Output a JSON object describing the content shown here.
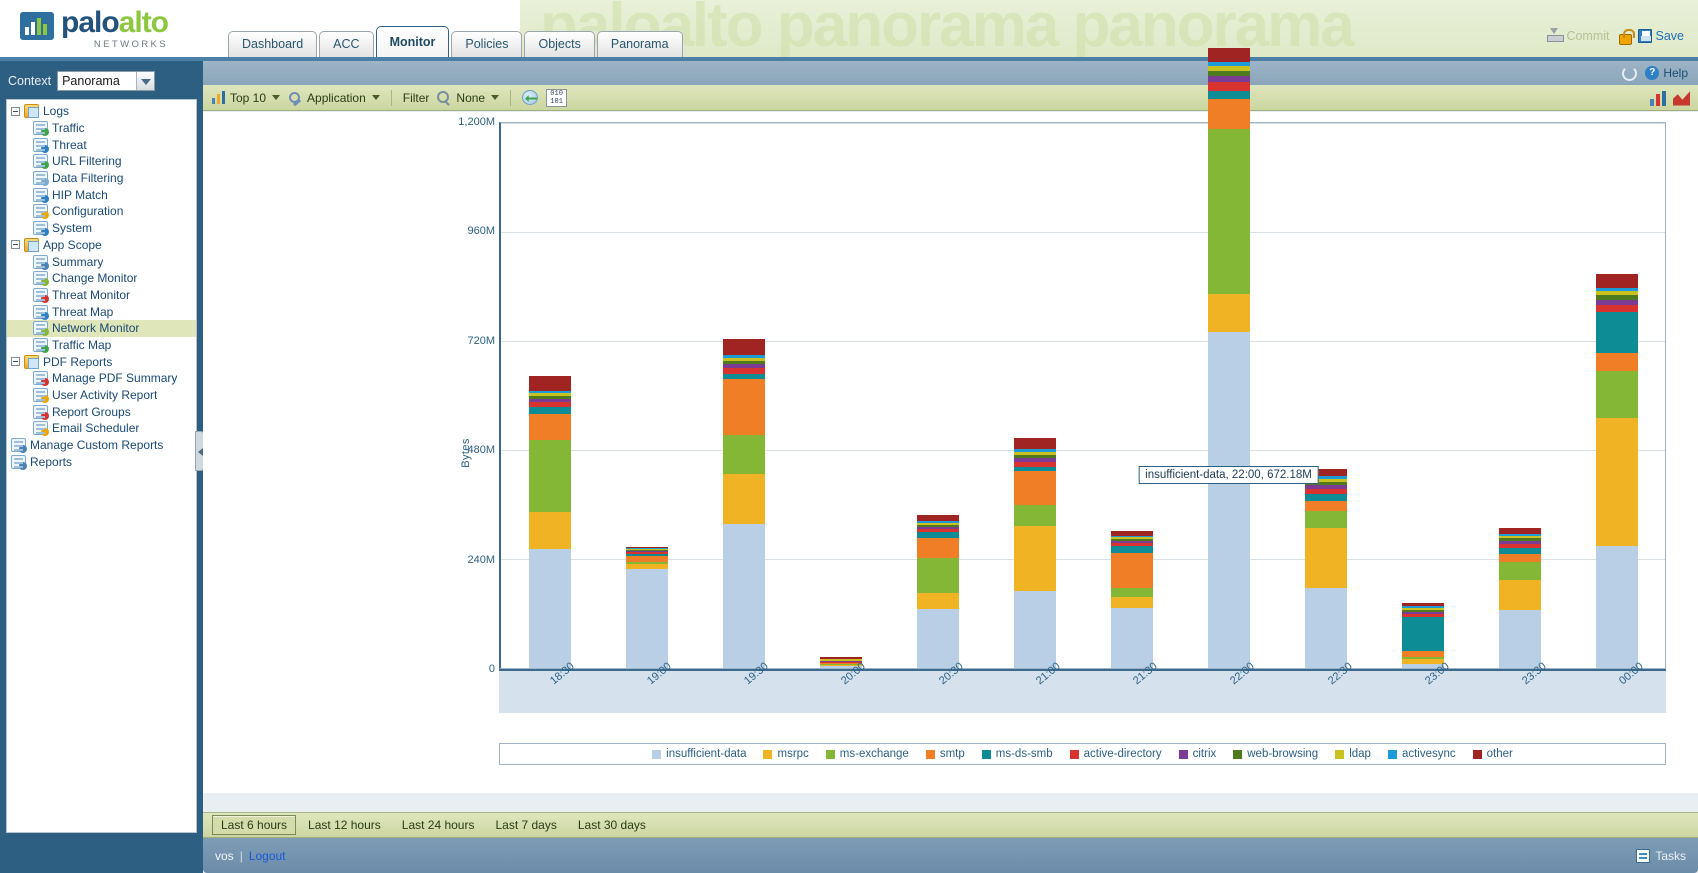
{
  "brand": {
    "name_part1": "palo",
    "name_part2": "alto",
    "tagline": "NETWORKS",
    "watermark": "paloalto panorama panorama"
  },
  "topbar": {
    "tabs": [
      {
        "label": "Dashboard",
        "active": false
      },
      {
        "label": "ACC",
        "active": false
      },
      {
        "label": "Monitor",
        "active": true
      },
      {
        "label": "Policies",
        "active": false
      },
      {
        "label": "Objects",
        "active": false
      },
      {
        "label": "Panorama",
        "active": false
      }
    ],
    "commit_label": "Commit",
    "save_label": "Save"
  },
  "context": {
    "label": "Context",
    "value": "Panorama"
  },
  "sidebar": {
    "items": [
      {
        "label": "Logs",
        "level": 1,
        "icon": "folder-icon",
        "expandable": true,
        "selected": false
      },
      {
        "label": "Traffic",
        "level": 2,
        "icon": "traffic-log-icon",
        "expandable": false,
        "selected": false
      },
      {
        "label": "Threat",
        "level": 2,
        "icon": "threat-log-icon",
        "expandable": false,
        "selected": false
      },
      {
        "label": "URL Filtering",
        "level": 2,
        "icon": "url-filtering-icon",
        "expandable": false,
        "selected": false
      },
      {
        "label": "Data Filtering",
        "level": 2,
        "icon": "data-filtering-icon",
        "expandable": false,
        "selected": false
      },
      {
        "label": "HIP Match",
        "level": 2,
        "icon": "hip-match-icon",
        "expandable": false,
        "selected": false
      },
      {
        "label": "Configuration",
        "level": 2,
        "icon": "configuration-icon",
        "expandable": false,
        "selected": false
      },
      {
        "label": "System",
        "level": 2,
        "icon": "system-icon",
        "expandable": false,
        "selected": false
      },
      {
        "label": "App Scope",
        "level": 1,
        "icon": "app-scope-icon",
        "expandable": true,
        "selected": false
      },
      {
        "label": "Summary",
        "level": 2,
        "icon": "summary-icon",
        "expandable": false,
        "selected": false
      },
      {
        "label": "Change Monitor",
        "level": 2,
        "icon": "change-monitor-icon",
        "expandable": false,
        "selected": false
      },
      {
        "label": "Threat Monitor",
        "level": 2,
        "icon": "threat-monitor-icon",
        "expandable": false,
        "selected": false
      },
      {
        "label": "Threat Map",
        "level": 2,
        "icon": "threat-map-icon",
        "expandable": false,
        "selected": false
      },
      {
        "label": "Network Monitor",
        "level": 2,
        "icon": "network-monitor-icon",
        "expandable": false,
        "selected": true
      },
      {
        "label": "Traffic Map",
        "level": 2,
        "icon": "traffic-map-icon",
        "expandable": false,
        "selected": false
      },
      {
        "label": "PDF Reports",
        "level": 1,
        "icon": "pdf-reports-icon",
        "expandable": true,
        "selected": false
      },
      {
        "label": "Manage PDF Summary",
        "level": 2,
        "icon": "manage-pdf-icon",
        "expandable": false,
        "selected": false
      },
      {
        "label": "User Activity Report",
        "level": 2,
        "icon": "user-activity-icon",
        "expandable": false,
        "selected": false
      },
      {
        "label": "Report Groups",
        "level": 2,
        "icon": "report-groups-icon",
        "expandable": false,
        "selected": false
      },
      {
        "label": "Email Scheduler",
        "level": 2,
        "icon": "email-scheduler-icon",
        "expandable": false,
        "selected": false
      },
      {
        "label": "Manage Custom Reports",
        "level": 1,
        "icon": "custom-reports-icon",
        "expandable": false,
        "selected": false
      },
      {
        "label": "Reports",
        "level": 1,
        "icon": "reports-icon",
        "expandable": false,
        "selected": false
      }
    ]
  },
  "main_header": {
    "help_label": "Help",
    "help_glyph": "?"
  },
  "toolbar": {
    "top_n": "Top 10",
    "group_by": "Application",
    "filter_label": "Filter",
    "filter_value": "None"
  },
  "time_range": {
    "buttons": [
      {
        "label": "Last 6 hours",
        "active": true
      },
      {
        "label": "Last 12 hours",
        "active": false
      },
      {
        "label": "Last 24 hours",
        "active": false
      },
      {
        "label": "Last 7 days",
        "active": false
      },
      {
        "label": "Last 30 days",
        "active": false
      }
    ]
  },
  "footer": {
    "user": "vos",
    "divider": "|",
    "logout": "Logout",
    "tasks": "Tasks"
  },
  "tooltip": {
    "text": "insufficient-data, 22:00, 672.18M"
  },
  "chart_data": {
    "type": "bar",
    "stacked": true,
    "title": "",
    "xlabel": "",
    "ylabel": "Bytes",
    "ylim": [
      0,
      1200
    ],
    "y_unit": "M",
    "y_ticks": [
      0,
      240,
      480,
      720,
      960,
      1200
    ],
    "y_tick_labels": [
      "0",
      "240M",
      "480M",
      "720M",
      "960M",
      "1,200M"
    ],
    "grid": true,
    "legend_position": "bottom",
    "categories": [
      "18:30",
      "19:00",
      "19:30",
      "20:00",
      "20:30",
      "21:00",
      "21:30",
      "22:00",
      "22:30",
      "23:00",
      "23:30",
      "00:00"
    ],
    "series": [
      {
        "name": "insufficient-data",
        "color": "#b8cfe5",
        "values": [
          238,
          198,
          288,
          4,
          118,
          155,
          120,
          672,
          160,
          8,
          117,
          245
        ]
      },
      {
        "name": "msrpc",
        "color": "#f0b323",
        "values": [
          75,
          10,
          100,
          2,
          32,
          130,
          22,
          77,
          120,
          10,
          60,
          255
        ]
      },
      {
        "name": "ms-exchange",
        "color": "#83b735",
        "values": [
          143,
          5,
          78,
          2,
          70,
          42,
          18,
          330,
          34,
          5,
          35,
          95
        ]
      },
      {
        "name": "smtp",
        "color": "#f07e26",
        "values": [
          52,
          12,
          112,
          2,
          40,
          67,
          70,
          60,
          20,
          12,
          17,
          35
        ]
      },
      {
        "name": "ms-ds-smb",
        "color": "#0e8c96",
        "values": [
          14,
          4,
          10,
          1,
          12,
          9,
          14,
          16,
          14,
          68,
          12,
          82
        ]
      },
      {
        "name": "active-directory",
        "color": "#d8332e",
        "values": [
          10,
          3,
          12,
          2,
          6,
          9,
          6,
          18,
          10,
          6,
          8,
          15
        ]
      },
      {
        "name": "citrix",
        "color": "#7c3c96",
        "values": [
          7,
          2,
          8,
          1,
          5,
          8,
          4,
          12,
          8,
          4,
          6,
          10
        ]
      },
      {
        "name": "web-browsing",
        "color": "#4f7a1e",
        "values": [
          6,
          2,
          7,
          1,
          4,
          7,
          4,
          10,
          7,
          4,
          5,
          9
        ]
      },
      {
        "name": "ldap",
        "color": "#c8c120",
        "values": [
          5,
          2,
          6,
          3,
          4,
          6,
          4,
          9,
          6,
          4,
          4,
          8
        ]
      },
      {
        "name": "activesync",
        "color": "#1b9bd8",
        "values": [
          5,
          2,
          6,
          1,
          4,
          6,
          3,
          8,
          6,
          3,
          4,
          7
        ]
      },
      {
        "name": "other",
        "color": "#a02422",
        "values": [
          30,
          3,
          32,
          4,
          12,
          22,
          10,
          28,
          14,
          6,
          12,
          28
        ]
      }
    ]
  }
}
